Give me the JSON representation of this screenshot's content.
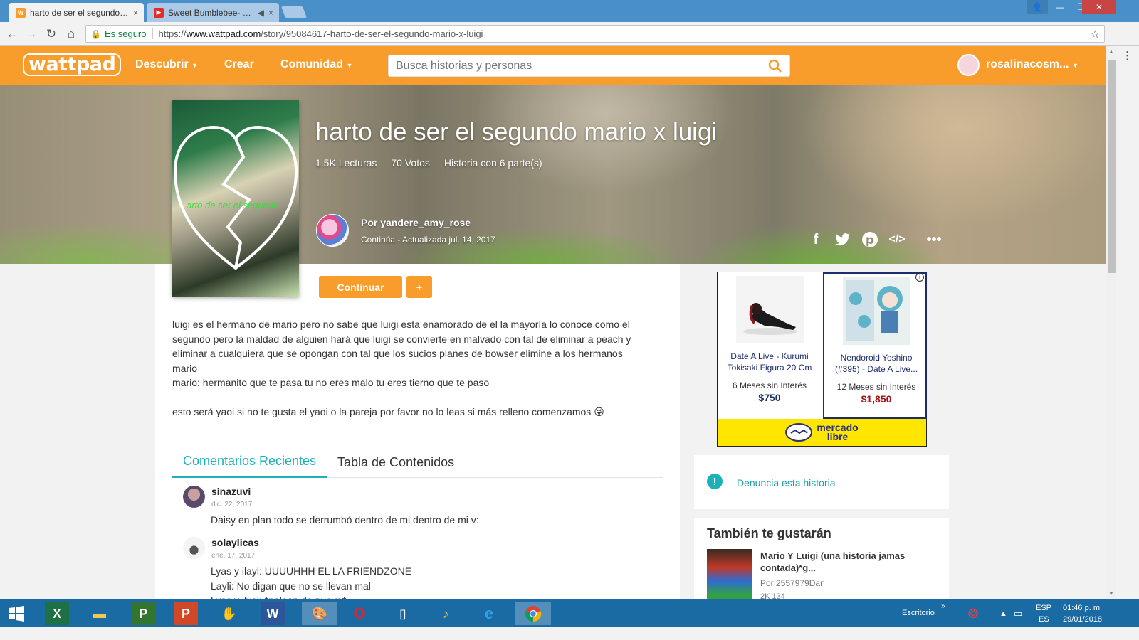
{
  "browser": {
    "tabs": [
      {
        "title": "harto de ser el segundo mario x luigi - Wattpad",
        "close": "×"
      },
      {
        "title": "Sweet Bumblebee- Peppa",
        "close": "×"
      }
    ],
    "security_label": "Es seguro",
    "url_prefix": "https://",
    "url_main": "www.wattpad.com",
    "url_path": "/story/95084617-harto-de-ser-el-segundo-mario-x-luigi"
  },
  "header": {
    "logo": "wattpad",
    "nav": [
      "Descubrir",
      "Crear",
      "Comunidad"
    ],
    "search_placeholder": "Busca historias y personas",
    "username": "rosalinacosm..."
  },
  "story": {
    "title": "harto de ser el segundo mario x luigi",
    "reads": "1.5K Lecturas",
    "votes": "70 Votos",
    "parts": "Historia con 6 parte(s)",
    "author": "Por yandere_amy_rose",
    "status": "Continúa - Actualizada jul. 14, 2017",
    "cover_text": "arto de ser el segundo",
    "continue_label": "Continuar",
    "add_label": "+",
    "description": [
      "luigi es el hermano de mario pero no sabe que luigi esta enamorado de el la mayoría lo conoce como el",
      "segundo pero la maldad de alguien hará que luigi se convierte en malvado con tal de eliminar a peach y",
      "eliminar a cualquiera que se opongan con tal que los sucios planes de bowser elimine a los hermanos",
      "mario",
      "mario: hermanito que te pasa tu no eres malo tu eres tierno que te paso",
      "esto será yaoi si no te gusta el yaoi o la pareja por favor no lo leas si más relleno comenzamos 😜"
    ]
  },
  "tabs": {
    "recent_comments": "Comentarios Recientes",
    "toc": "Tabla de Contenidos"
  },
  "comments": [
    {
      "user": "sinazuvi",
      "date": "dic. 22, 2017",
      "lines": [
        "Daisy en plan todo se derrumbó dentro de mi dentro de mi v:"
      ]
    },
    {
      "user": "solaylicas",
      "date": "ene. 17, 2017",
      "lines": [
        "Lyas y ilayl: UUUUHHH EL LA FRIENDZONE",
        "Layli: No digan que no se llevan mal",
        "Lyas y ilyal: *pelean de nuevo*"
      ]
    }
  ],
  "ad": {
    "items": [
      {
        "title": "Date A Live - Kurumi Tokisaki Figura 20 Cm",
        "msi": "6 Meses sin Interés",
        "price": "$750",
        "price_color": "#1c2d6b"
      },
      {
        "title": "Nendoroid Yoshino (#395) - Date A Live...",
        "msi": "12 Meses sin Interés",
        "price": "$1,850",
        "price_color": "#a01818"
      }
    ],
    "brand_line1": "mercado",
    "brand_line2": "libre",
    "info": "i"
  },
  "report": {
    "label": "Denuncia esta historia"
  },
  "also": {
    "heading": "También te gustarán",
    "title": "Mario Y Luigi (una historia jamas contada)*g...",
    "author": "Por 2557979Dan",
    "stats": "2K   134"
  },
  "taskbar": {
    "desktop_label": "Escritorio",
    "lang1": "ESP",
    "lang2": "ES",
    "time": "01:46 p. m.",
    "date": "29/01/2018"
  },
  "colors": {
    "brand": "#f89d2b",
    "accent": "#1bb1b9",
    "taskbar": "#1a6aa3"
  }
}
